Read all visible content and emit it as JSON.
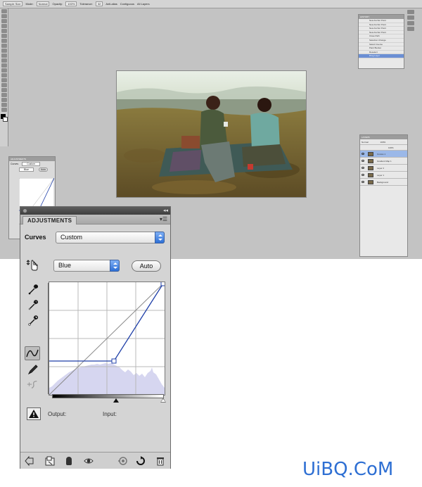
{
  "options_bar": {
    "items": [
      "Sample Size",
      "Mode:",
      "Normal",
      "Opacity:",
      "100%",
      "Tolerance:",
      "32",
      "Anti-alias",
      "Contiguous",
      "All Layers"
    ]
  },
  "history": {
    "title": "HISTORY",
    "items": [
      "New Anchor Point",
      "New Anchor Point",
      "New Anchor Point",
      "New Anchor Point",
      "Close Path",
      "Selection Change",
      "Select Inverse",
      "Paint Bucket",
      "Deselect",
      "Drag Layer"
    ],
    "selected_index": 9
  },
  "layers": {
    "title": "LAYERS",
    "blend_mode": "Normal",
    "opacity": "100%",
    "fill": "100%",
    "rows": [
      {
        "name": "Curves 1",
        "selected": true
      },
      {
        "name": "Gradient Map 1",
        "selected": false
      },
      {
        "name": "Layer 2",
        "selected": false
      },
      {
        "name": "Layer 1",
        "selected": false
      },
      {
        "name": "Background",
        "selected": false
      }
    ]
  },
  "adjustments": {
    "tab_label": "ADJUSTMENTS",
    "curves_label": "Curves",
    "preset_value": "Custom",
    "channel_value": "Blue",
    "auto_label": "Auto",
    "output_label": "Output:",
    "input_label": "Input:"
  },
  "mini_adj": {
    "title": "ADJUSTMENTS",
    "curves_label": "Curves",
    "preset_value": "Custom",
    "channel_value": "Blue",
    "auto_label": "Auto"
  },
  "watermark": "UiBQ.CoM",
  "colors": {
    "accent": "#2d6fd6",
    "curve": "#1f3fa8",
    "histogram": "#d6d6f0",
    "watermark": "#2e6fd3"
  }
}
